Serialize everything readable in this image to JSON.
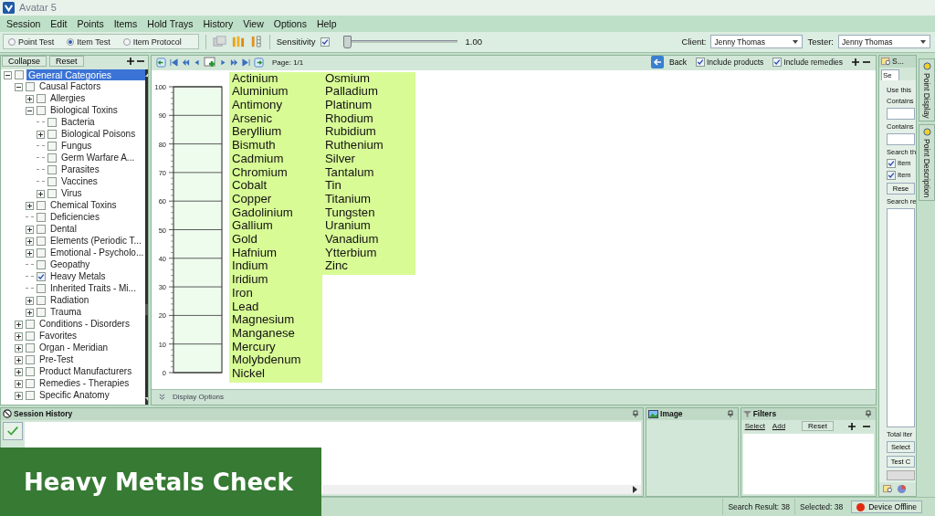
{
  "window": {
    "title": "Avatar 5"
  },
  "menu": [
    "Session",
    "Edit",
    "Points",
    "Items",
    "Hold Trays",
    "History",
    "View",
    "Options",
    "Help"
  ],
  "toolbar": {
    "test_modes": [
      {
        "label": "Point Test",
        "selected": false
      },
      {
        "label": "Item Test",
        "selected": true
      },
      {
        "label": "Item Protocol",
        "selected": false
      }
    ],
    "sensitivity": {
      "label": "Sensitivity",
      "checked": true,
      "level": 0.03,
      "reading": "1.00"
    },
    "client": {
      "label": "Client:",
      "value": "Jenny Thomas"
    },
    "tester": {
      "label": "Tester:",
      "value": "Jenny Thomas"
    }
  },
  "tree_panel": {
    "buttons": [
      "Collapse",
      "Reset"
    ],
    "tree": [
      {
        "label": "General Categories",
        "kind": "folder",
        "expanded": true,
        "checked": false,
        "selected": true,
        "children": [
          {
            "label": "Causal Factors",
            "kind": "folder",
            "expanded": true,
            "checked": false,
            "selected": false,
            "children": [
              {
                "label": "Allergies",
                "kind": "folder",
                "expanded": false,
                "checked": false,
                "selected": false
              },
              {
                "label": "Biological Toxins",
                "kind": "folder",
                "expanded": true,
                "checked": false,
                "selected": false,
                "children": [
                  {
                    "label": "Bacteria",
                    "kind": "leaf",
                    "checked": false,
                    "selected": false
                  },
                  {
                    "label": "Biological Poisons",
                    "kind": "folder",
                    "expanded": false,
                    "checked": false,
                    "selected": false
                  },
                  {
                    "label": "Fungus",
                    "kind": "leaf",
                    "checked": false,
                    "selected": false
                  },
                  {
                    "label": "Germ Warfare A...",
                    "kind": "leaf",
                    "checked": false,
                    "selected": false
                  },
                  {
                    "label": "Parasites",
                    "kind": "leaf",
                    "checked": false,
                    "selected": false
                  },
                  {
                    "label": "Vaccines",
                    "kind": "leaf",
                    "checked": false,
                    "selected": false
                  },
                  {
                    "label": "Virus",
                    "kind": "folder",
                    "expanded": false,
                    "checked": false,
                    "selected": false
                  }
                ]
              },
              {
                "label": "Chemical Toxins",
                "kind": "folder",
                "expanded": false,
                "checked": false,
                "selected": false
              },
              {
                "label": "Deficiencies",
                "kind": "leaf",
                "checked": false,
                "selected": false
              },
              {
                "label": "Dental",
                "kind": "folder",
                "expanded": false,
                "checked": false,
                "selected": false
              },
              {
                "label": "Elements (Periodic T...",
                "kind": "folder",
                "expanded": false,
                "checked": false,
                "selected": false
              },
              {
                "label": "Emotional - Psycholo...",
                "kind": "folder",
                "expanded": false,
                "checked": false,
                "selected": false
              },
              {
                "label": "Geopathy",
                "kind": "leaf",
                "checked": false,
                "selected": false
              },
              {
                "label": "Heavy Metals",
                "kind": "leaf",
                "checked": true,
                "selected": false
              },
              {
                "label": "Inherited Traits - Mi...",
                "kind": "leaf",
                "checked": false,
                "selected": false
              },
              {
                "label": "Radiation",
                "kind": "folder",
                "expanded": false,
                "checked": false,
                "selected": false
              },
              {
                "label": "Trauma",
                "kind": "folder",
                "expanded": false,
                "checked": false,
                "selected": false
              }
            ]
          },
          {
            "label": "Conditions - Disorders",
            "kind": "folder",
            "expanded": false,
            "checked": false,
            "selected": false
          },
          {
            "label": "Favorites",
            "kind": "folder",
            "expanded": false,
            "checked": false,
            "selected": false
          },
          {
            "label": "Organ - Meridian",
            "kind": "folder",
            "expanded": false,
            "checked": false,
            "selected": false
          },
          {
            "label": "Pre-Test",
            "kind": "folder",
            "expanded": false,
            "checked": false,
            "selected": false
          },
          {
            "label": "Product Manufacturers",
            "kind": "folder",
            "expanded": false,
            "checked": false,
            "selected": false
          },
          {
            "label": "Remedies - Therapies",
            "kind": "folder",
            "expanded": false,
            "checked": false,
            "selected": false
          },
          {
            "label": "Specific Anatomy",
            "kind": "folder",
            "expanded": false,
            "checked": false,
            "selected": false
          }
        ]
      }
    ]
  },
  "results": {
    "page": "Page: 1/1",
    "back": "Back",
    "options": [
      {
        "label": "Include products",
        "checked": true
      },
      {
        "label": "Include remedies",
        "checked": true
      }
    ],
    "meter": {
      "ticks": [
        "100",
        "90",
        "80",
        "70",
        "60",
        "50",
        "40",
        "30",
        "20",
        "10",
        "0"
      ]
    },
    "item_columns": [
      [
        "Actinium",
        "Aluminium",
        "Antimony",
        "Arsenic",
        "Beryllium",
        "Bismuth",
        "Cadmium",
        "Chromium",
        "Cobalt",
        "Copper",
        "Gadolinium",
        "Gallium",
        "Gold",
        "Hafnium",
        "Indium",
        "Iridium",
        "Iron",
        "Lead",
        "Magnesium",
        "Manganese",
        "Mercury",
        "Molybdenum",
        "Nickel"
      ],
      [
        "Osmium",
        "Palladium",
        "Platinum",
        "Rhodium",
        "Rubidium",
        "Ruthenium",
        "Silver",
        "Tantalum",
        "Tin",
        "Titanium",
        "Tungsten",
        "Uranium",
        "Vanadium",
        "Ytterbium",
        "Zinc"
      ]
    ],
    "display_options": "Display Options"
  },
  "search_panel": {
    "title": "S...",
    "tab": "Se",
    "intro": "Use this",
    "fields": [
      {
        "label": "Contains"
      },
      {
        "label": "Contains"
      }
    ],
    "search_label": "Search th",
    "options": [
      {
        "label": "Item",
        "checked": true
      },
      {
        "label": "Item",
        "checked": true
      }
    ],
    "reset": "Rese",
    "results_label": "Search re",
    "total": "Total iter",
    "buttons": [
      "Select",
      "Test C"
    ]
  },
  "side_tabs": [
    "Point Display",
    "Point Description"
  ],
  "session_history": {
    "title": "Session History"
  },
  "image_panel": {
    "title": "Image"
  },
  "filters": {
    "title": "Filters",
    "links": [
      "Select",
      "Add"
    ],
    "reset": "Reset"
  },
  "status_bar": {
    "search_result": "Search Result: 38",
    "selected": "Selected: 38",
    "device": "Device Offline",
    "device_online": false
  },
  "banner": {
    "text": "Heavy Metals Check"
  }
}
